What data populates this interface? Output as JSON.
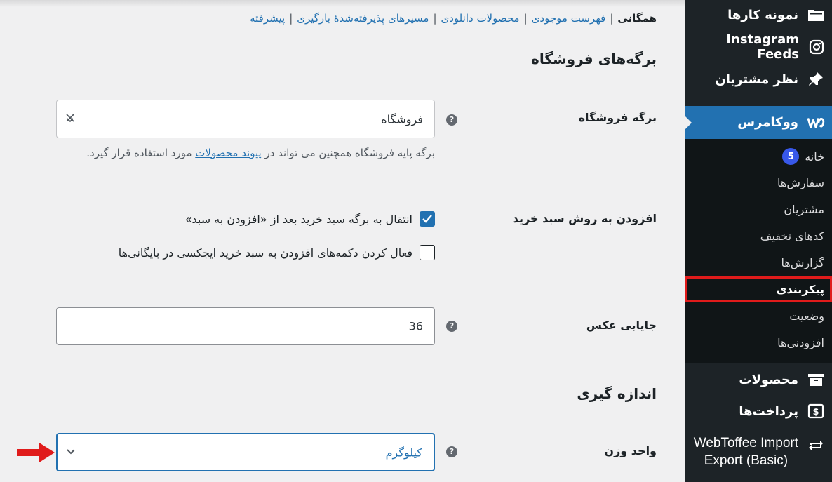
{
  "sidebar": {
    "menu_top": [
      {
        "label": "نمونه کارها",
        "icon": "folder-icon"
      },
      {
        "label": "Instagram Feeds",
        "icon": "instagram-icon"
      },
      {
        "label": "نظر مشتریان",
        "icon": "pin-icon"
      }
    ],
    "woocommerce": {
      "label": "ووکامرس",
      "icon": "woocommerce-icon"
    },
    "submenu": [
      {
        "label": "خانه",
        "badge": "5"
      },
      {
        "label": "سفارش‌ها"
      },
      {
        "label": "مشتریان"
      },
      {
        "label": "کدهای تخفیف"
      },
      {
        "label": "گزارش‌ها"
      },
      {
        "label": "پیکربندی"
      },
      {
        "label": "وضعیت"
      },
      {
        "label": "افزودنی‌ها"
      }
    ],
    "menu_bottom": [
      {
        "label": "محصولات",
        "icon": "archive-icon"
      },
      {
        "label": "پرداخت‌ها",
        "icon": "dollar-icon"
      },
      {
        "label_line1": "WebToffee Import",
        "label_line2": "Export (Basic)",
        "icon": "sync-icon"
      }
    ]
  },
  "tabs": {
    "current": "همگانی",
    "links": [
      "فهرست موجودی",
      "محصولات دانلودی",
      "مسیرهای پذیرفته‌شدهٔ بارگیری",
      "پیشرفته"
    ],
    "separator": "|"
  },
  "shop_pages": {
    "title": "برگه‌های فروشگاه",
    "shop_page_label": "برگه فروشگاه",
    "shop_page_value": "فروشگاه",
    "desc_before": "برگه پایه فروشگاه همچنین می تواند در",
    "desc_link": "پیوند محصولات",
    "desc_after": "مورد استفاده قرار گیرد.",
    "add_to_cart_label": "افزودن به روش سبد خرید",
    "redirect_label": "انتقال به برگه سبد خرید بعد از «افزودن به سبد»",
    "redirect_checked": true,
    "ajax_label": "فعال کردن دکمه‌های افزودن به سبد خرید ایجکسی در بایگانی‌ها",
    "ajax_checked": false,
    "placeholder_label": "جایابی عکس",
    "placeholder_value": "36"
  },
  "measurements": {
    "title": "اندازه گیری",
    "weight_label": "واحد وزن",
    "weight_value": "کیلوگرم"
  },
  "help_glyph": "?",
  "colors": {
    "accent": "#2271b1",
    "sidebar": "#1d2327",
    "highlight": "#e01b1b",
    "badge": "#3858e9"
  }
}
